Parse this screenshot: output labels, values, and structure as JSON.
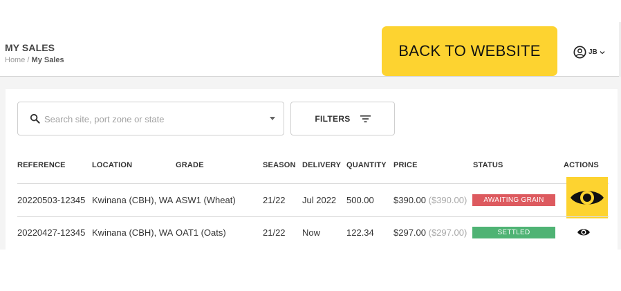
{
  "header": {
    "title": "MY SALES",
    "breadcrumb_home": "Home",
    "breadcrumb_sep": "/",
    "breadcrumb_current": "My Sales",
    "back_label": "BACK TO WEBSITE",
    "user_initials": "JB",
    "user_icon": "account-circle-icon"
  },
  "toolbar": {
    "search_placeholder": "Search site, port zone or state",
    "search_value": "",
    "search_icon": "search-icon",
    "filters_label": "FILTERS",
    "filters_icon": "filter-lines-icon"
  },
  "table": {
    "columns": [
      "REFERENCE",
      "LOCATION",
      "GRADE",
      "SEASON",
      "DELIVERY",
      "QUANTITY",
      "PRICE",
      "STATUS",
      "ACTIONS"
    ],
    "rows": [
      {
        "reference": "20220503-12345",
        "location": "Kwinana (CBH), WA",
        "grade": "ASW1 (Wheat)",
        "season": "21/22",
        "delivery": "Jul 2022",
        "quantity": "500.00",
        "price": "$390.00",
        "price_sub": "($390.00)",
        "status": "AWAITING GRAIN",
        "status_color": "#dd5a5f",
        "action_icon": "eye-icon"
      },
      {
        "reference": "20220427-12345",
        "location": "Kwinana (CBH), WA",
        "grade": "OAT1 (Oats)",
        "season": "21/22",
        "delivery": "Now",
        "quantity": "122.34",
        "price": "$297.00",
        "price_sub": "($297.00)",
        "status": "SETTLED",
        "status_color": "#4fb374",
        "action_icon": "eye-icon"
      }
    ]
  },
  "colors": {
    "accent_yellow": "#fdd330",
    "awaiting": "#dd5a5f",
    "settled": "#4fb374"
  }
}
